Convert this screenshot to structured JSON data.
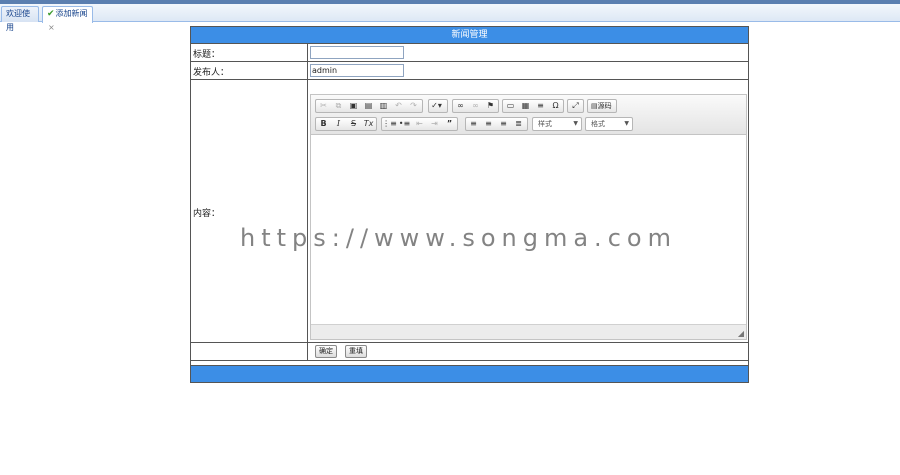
{
  "tabs": [
    {
      "label": "欢迎使用"
    },
    {
      "label": "添加新闻",
      "close": "×"
    }
  ],
  "form": {
    "header": "新闻管理",
    "title_label": "标题：",
    "title_value": "",
    "publisher_label": "发布人：",
    "publisher_value": "admin",
    "content_label": "内容：",
    "submit_label": "确定",
    "reset_label": "重填"
  },
  "editor": {
    "toolbar_row1": [
      {
        "group": "clipboard",
        "icons": [
          "cut-icon",
          "copy-icon",
          "paste-icon",
          "paste-text-icon",
          "paste-word-icon",
          "undo-icon",
          "redo-icon"
        ]
      },
      {
        "group": "spell",
        "icons": [
          "spellcheck-icon"
        ]
      },
      {
        "group": "links",
        "icons": [
          "link-icon",
          "unlink-icon",
          "anchor-icon"
        ]
      },
      {
        "group": "insert",
        "icons": [
          "image-icon",
          "table-icon",
          "horizontal-rule-icon",
          "special-char-icon"
        ]
      },
      {
        "group": "tools",
        "icons": [
          "maximize-icon"
        ]
      },
      {
        "group": "document",
        "icons": [
          "source-icon"
        ]
      }
    ],
    "source_label": "源码",
    "toolbar_row2": [
      {
        "group": "basicstyles",
        "icons": [
          "bold-icon",
          "italic-icon",
          "strike-icon",
          "remove-format-icon"
        ]
      },
      {
        "group": "list",
        "icons": [
          "numbered-list-icon",
          "bulleted-list-icon",
          "outdent-icon",
          "indent-icon",
          "blockquote-icon"
        ]
      },
      {
        "group": "align",
        "icons": [
          "align-left-icon",
          "align-center-icon",
          "align-right-icon",
          "align-justify-icon"
        ]
      }
    ],
    "styles_combo": "样式",
    "format_combo": "格式",
    "content": ""
  },
  "watermark": "https://www.songma.com"
}
